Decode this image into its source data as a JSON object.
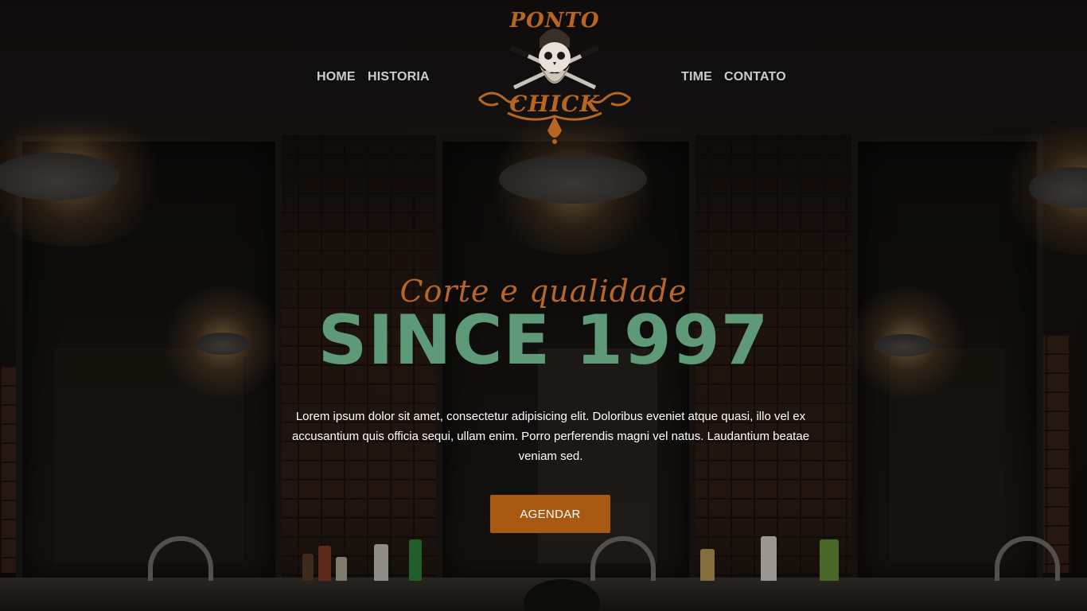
{
  "nav": {
    "left": [
      {
        "label": "HOME"
      },
      {
        "label": "HISTORIA"
      }
    ],
    "right": [
      {
        "label": "TIME"
      },
      {
        "label": "CONTATO"
      }
    ]
  },
  "logo": {
    "line1": "PONTO",
    "line2": "CHICK",
    "icon": "bearded-skull-with-razors"
  },
  "hero": {
    "tagline": "Corte e qualidade",
    "headline": "SINCE 1997",
    "description": "Lorem ipsum dolor sit amet, consectetur adipisicing elit. Doloribus eveniet atque quasi, illo vel ex accusantium quis officia sequi, ullam enim. Porro perferendis magni vel natus. Laudantium beatae veniam sed.",
    "cta_label": "AGENDAR"
  },
  "colors": {
    "accent": "#a85912",
    "logo": "#b8661f",
    "headline": "#5e9a78",
    "nav_text": "#c8ccd0"
  }
}
